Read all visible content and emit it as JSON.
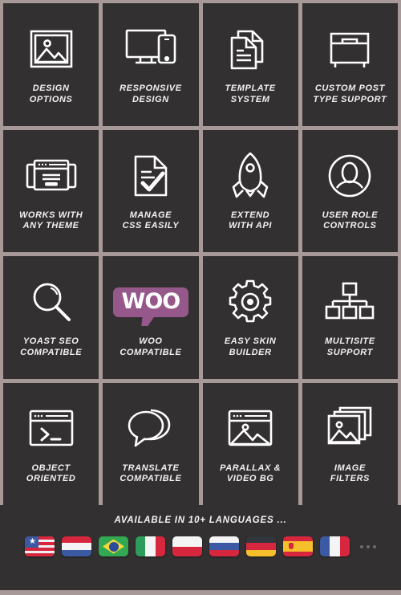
{
  "theme": {
    "tile_bg": "#333031",
    "page_bg": "#a89999",
    "icon_color": "#ffffff",
    "text_color": "#f2f2f2",
    "woo_purple": "#96588a"
  },
  "features": [
    {
      "id": "design-options",
      "icon": "image-frame-icon",
      "label": "DESIGN\nOPTIONS"
    },
    {
      "id": "responsive-design",
      "icon": "desktop-mobile-icon",
      "label": "RESPONSIVE\nDESIGN"
    },
    {
      "id": "template-system",
      "icon": "documents-icon",
      "label": "TEMPLATE\nSYSTEM"
    },
    {
      "id": "custom-post-type",
      "icon": "archive-box-icon",
      "label": "CUSTOM POST\nTYPE SUPPORT"
    },
    {
      "id": "works-any-theme",
      "icon": "browser-windows-icon",
      "label": "WORKS WITH\nANY THEME"
    },
    {
      "id": "manage-css",
      "icon": "document-check-icon",
      "label": "MANAGE\nCSS EASILY"
    },
    {
      "id": "extend-api",
      "icon": "rocket-icon",
      "label": "EXTEND\nWITH API"
    },
    {
      "id": "user-role-controls",
      "icon": "user-circle-icon",
      "label": "USER ROLE\nCONTROLS"
    },
    {
      "id": "yoast-seo",
      "icon": "magnifier-icon",
      "label": "YOAST SEO\nCOMPATIBLE"
    },
    {
      "id": "woo-compatible",
      "icon": "woo-logo-icon",
      "label": "WOO\nCOMPATIBLE",
      "logo_text": "WOO"
    },
    {
      "id": "easy-skin-builder",
      "icon": "gear-icon",
      "label": "EASY SKIN\nBUILDER"
    },
    {
      "id": "multisite-support",
      "icon": "sitemap-icon",
      "label": "MULTISITE\nSUPPORT"
    },
    {
      "id": "object-oriented",
      "icon": "terminal-window-icon",
      "label": "OBJECT\nORIENTED"
    },
    {
      "id": "translate-compatible",
      "icon": "speech-bubbles-icon",
      "label": "TRANSLATE\nCOMPATIBLE"
    },
    {
      "id": "parallax-video-bg",
      "icon": "browser-image-icon",
      "label": "PARALLAX &\nVIDEO BG"
    },
    {
      "id": "image-filters",
      "icon": "image-stack-icon",
      "label": "IMAGE\nFILTERS"
    }
  ],
  "languages": {
    "heading": "AVAILABLE IN 10+ LANGUAGES ...",
    "more_indicator": "...",
    "flags": [
      {
        "id": "flag-us",
        "name": "united-states-flag"
      },
      {
        "id": "flag-nl",
        "name": "netherlands-flag"
      },
      {
        "id": "flag-br",
        "name": "brazil-flag"
      },
      {
        "id": "flag-it",
        "name": "italy-flag"
      },
      {
        "id": "flag-pl",
        "name": "poland-flag"
      },
      {
        "id": "flag-ru",
        "name": "russia-flag"
      },
      {
        "id": "flag-de",
        "name": "germany-flag"
      },
      {
        "id": "flag-es",
        "name": "spain-flag"
      },
      {
        "id": "flag-fr",
        "name": "france-flag"
      }
    ]
  }
}
